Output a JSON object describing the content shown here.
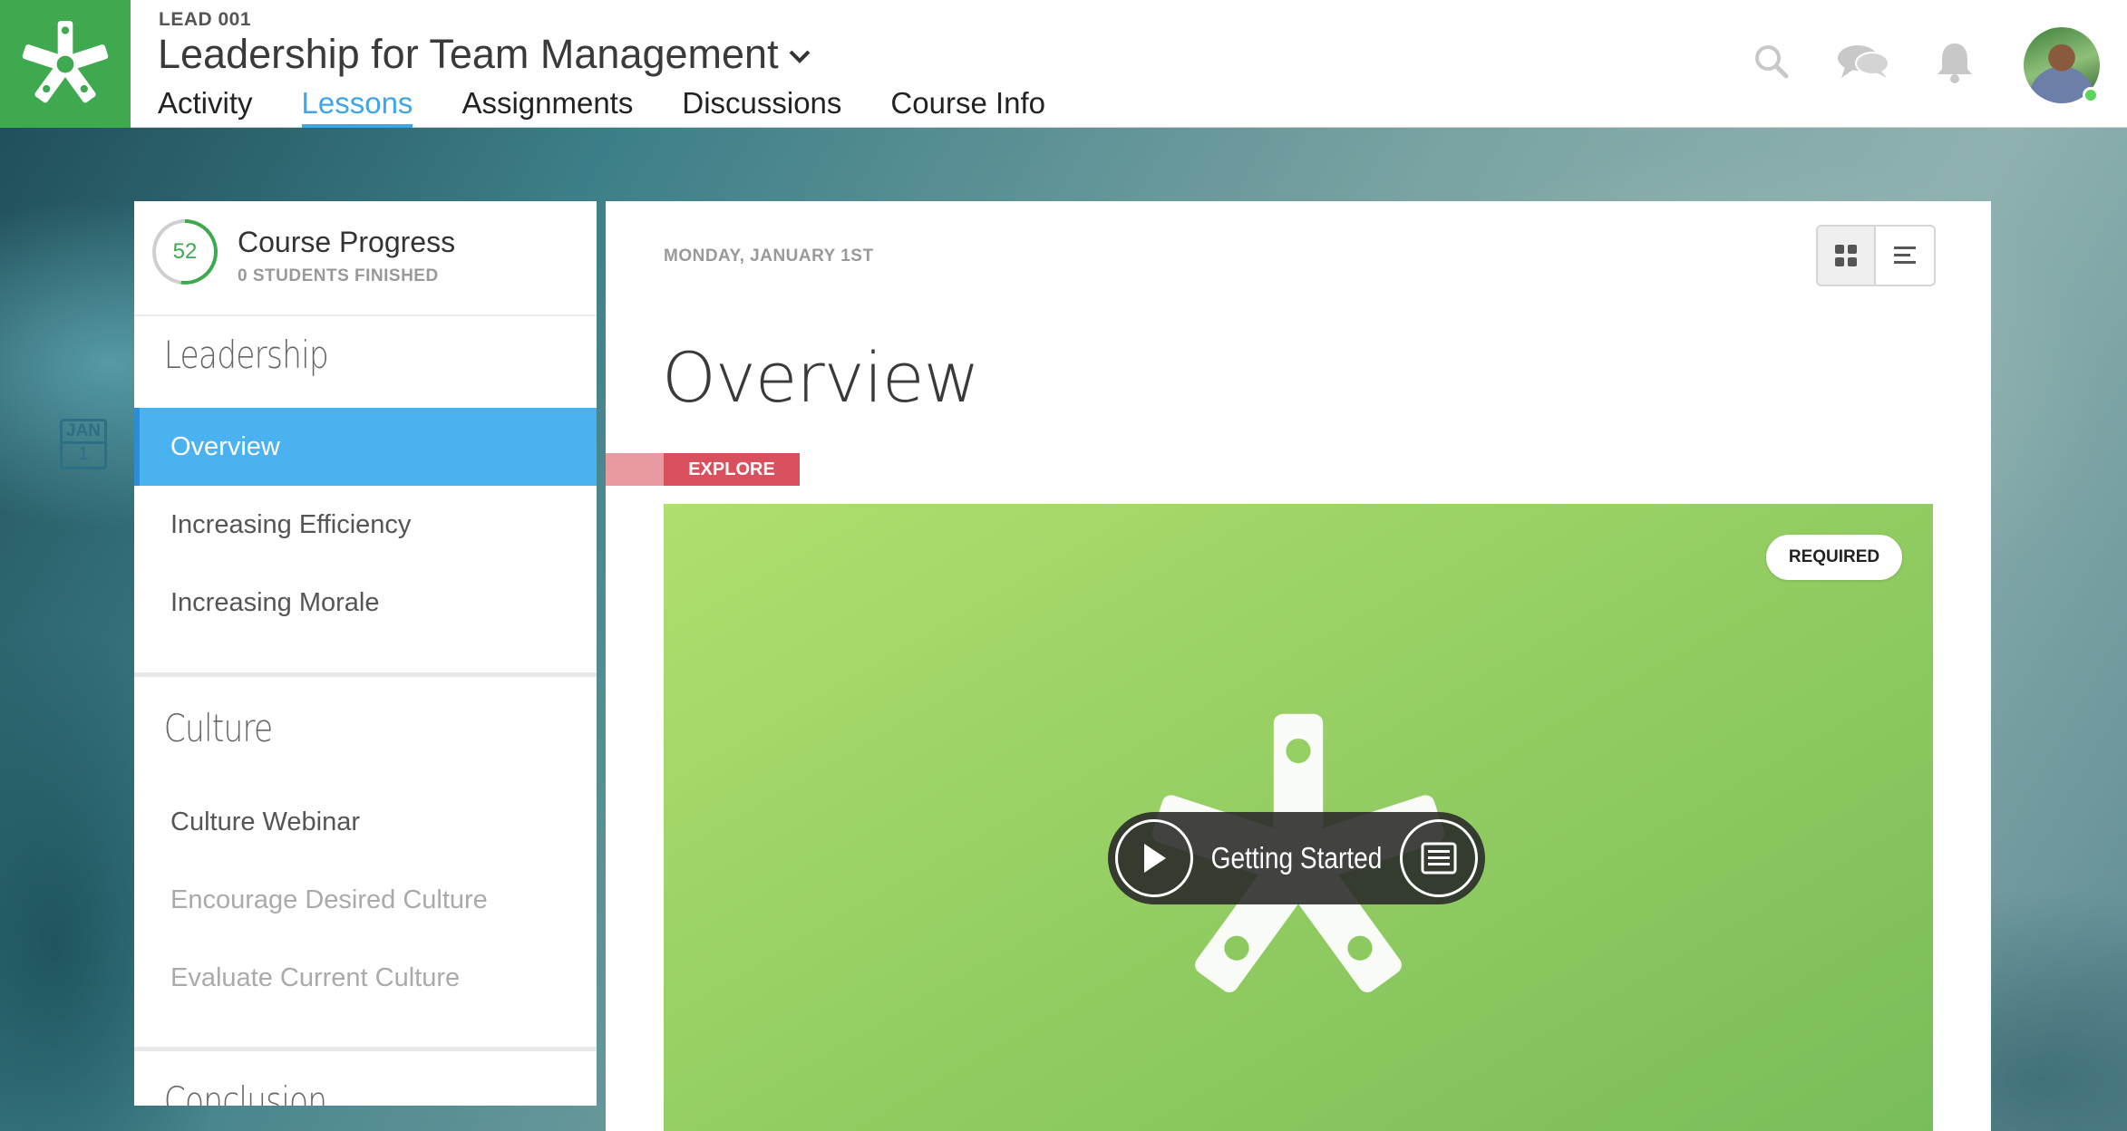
{
  "header": {
    "course_code": "LEAD 001",
    "course_title": "Leadership for Team Management",
    "tabs": [
      {
        "label": "Activity",
        "active": false
      },
      {
        "label": "Lessons",
        "active": true
      },
      {
        "label": "Assignments",
        "active": false
      },
      {
        "label": "Discussions",
        "active": false
      },
      {
        "label": "Course Info",
        "active": false
      }
    ],
    "icons": [
      "search-icon",
      "chat-icon",
      "bell-icon"
    ],
    "brand_color": "#3ea94e",
    "accent_color": "#3ea6e6"
  },
  "date_tag": {
    "month": "JAN",
    "day": "1"
  },
  "sidebar": {
    "progress": {
      "value": "52",
      "title": "Course Progress",
      "subtitle": "0 STUDENTS FINISHED",
      "percent": 52
    },
    "sections": [
      {
        "title": "Leadership",
        "items": [
          {
            "label": "Overview",
            "state": "active"
          },
          {
            "label": "Increasing Efficiency",
            "state": "normal"
          },
          {
            "label": "Increasing Morale",
            "state": "normal"
          }
        ]
      },
      {
        "title": "Culture",
        "items": [
          {
            "label": "Culture Webinar",
            "state": "normal"
          },
          {
            "label": "Encourage Desired Culture",
            "state": "dim"
          },
          {
            "label": "Evaluate Current Culture",
            "state": "dim"
          }
        ]
      },
      {
        "title": "Conclusion",
        "items": []
      }
    ]
  },
  "main": {
    "date": "MONDAY, JANUARY 1ST",
    "title": "Overview",
    "tag": "EXPLORE",
    "tag_color": "#d8505d",
    "card": {
      "badge": "REQUIRED",
      "media_label": "Getting Started",
      "background": "#96cf63"
    }
  }
}
